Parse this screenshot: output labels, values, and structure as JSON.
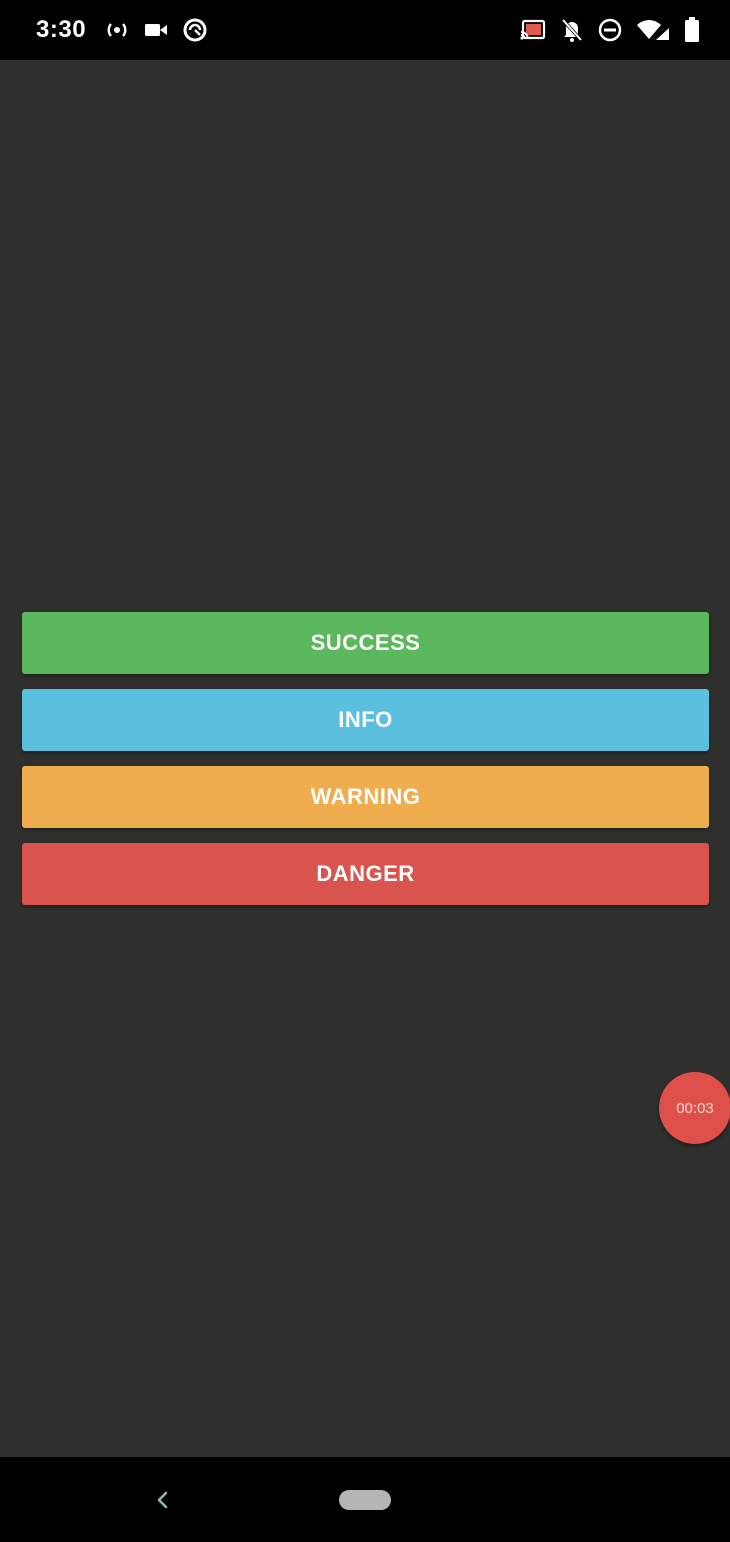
{
  "status_bar": {
    "time": "3:30",
    "left_icons": [
      "hotspot-icon",
      "video-camera-icon",
      "data-saver-icon"
    ],
    "right_icons": [
      "cast-icon",
      "notifications-off-icon",
      "do-not-disturb-icon",
      "wifi-icon",
      "battery-icon"
    ]
  },
  "buttons": [
    {
      "label": "SUCCESS",
      "color": "#5cb85c"
    },
    {
      "label": "INFO",
      "color": "#5bc0de"
    },
    {
      "label": "WARNING",
      "color": "#f0ad4e"
    },
    {
      "label": "DANGER",
      "color": "#d9534f"
    }
  ],
  "timer": {
    "text": "00:03",
    "color": "#e0504a"
  },
  "nav_bar": {
    "icons": [
      "back-icon",
      "home-pill"
    ]
  },
  "colors": {
    "background": "#2f302e",
    "system_bars": "#000000",
    "button_text": "#ffffff"
  }
}
